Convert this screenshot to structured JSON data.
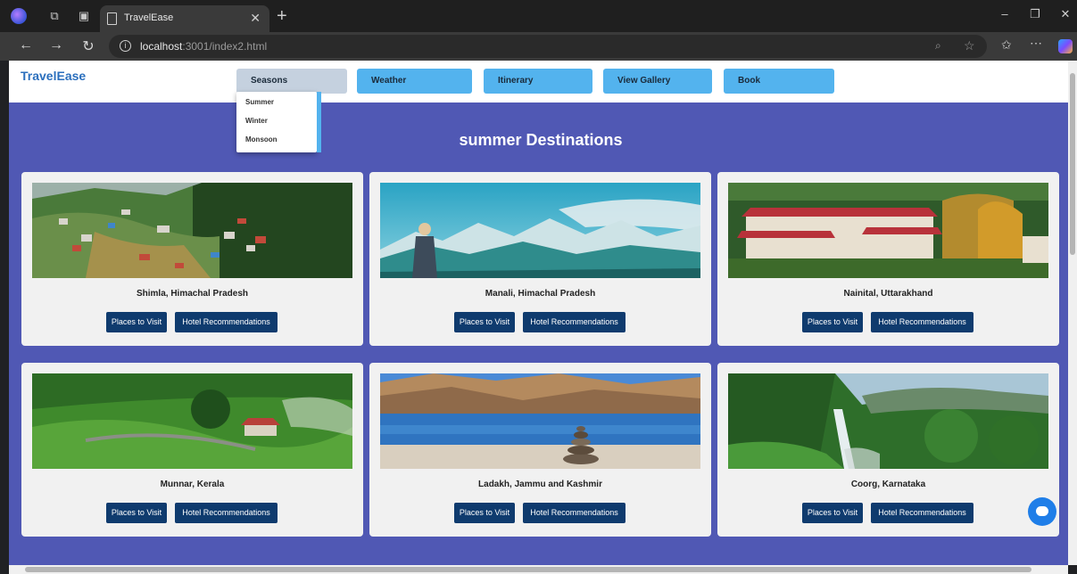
{
  "browser": {
    "tab_title": "TravelEase",
    "url_host": "localhost",
    "url_rest": ":3001/index2.html"
  },
  "site": {
    "logo": "TravelEase",
    "nav": [
      {
        "label": "Seasons"
      },
      {
        "label": "Weather"
      },
      {
        "label": "Itinerary"
      },
      {
        "label": "View Gallery"
      },
      {
        "label": "Book"
      }
    ],
    "seasons_menu": [
      "Summer",
      "Winter",
      "Monsoon"
    ]
  },
  "main": {
    "title": "summer Destinations",
    "places_label": "Places to Visit",
    "hotel_label": "Hotel Recommendations",
    "destinations": [
      {
        "name": "Shimla, Himachal Pradesh"
      },
      {
        "name": "Manali, Himachal Pradesh"
      },
      {
        "name": "Nainital, Uttarakhand"
      },
      {
        "name": "Munnar, Kerala"
      },
      {
        "name": "Ladakh, Jammu and Kashmir"
      },
      {
        "name": "Coorg, Karnataka"
      }
    ]
  },
  "colors": {
    "page_bg": "#5058b4",
    "nav_button": "#53b3ee",
    "card_button": "#0f3b6e",
    "logo": "#2b6fbd"
  }
}
